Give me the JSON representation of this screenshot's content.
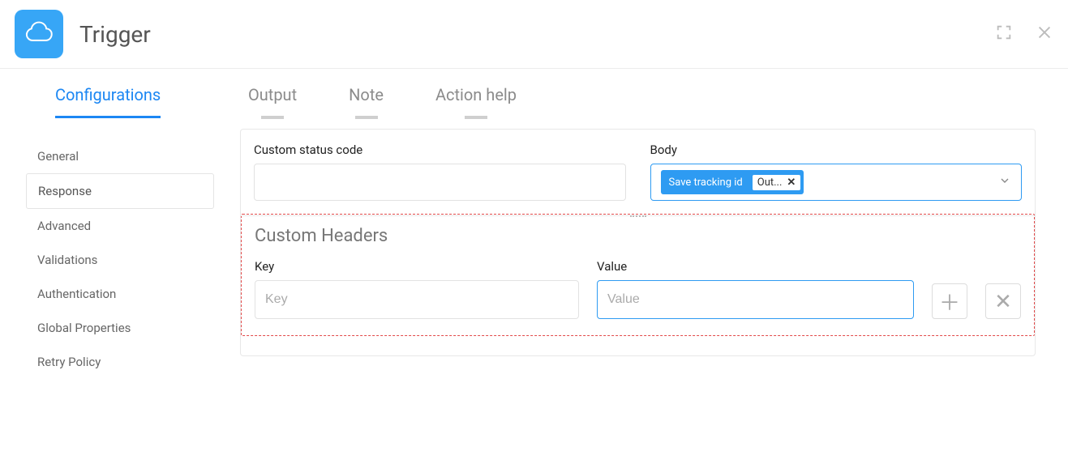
{
  "header": {
    "title": "Trigger"
  },
  "tabs": {
    "active": "Configurations",
    "others": [
      "Output",
      "Note",
      "Action help"
    ]
  },
  "sidebar": {
    "items": [
      {
        "label": "General",
        "active": false
      },
      {
        "label": "Response",
        "active": true
      },
      {
        "label": "Advanced",
        "active": false
      },
      {
        "label": "Validations",
        "active": false
      },
      {
        "label": "Authentication",
        "active": false
      },
      {
        "label": "Global Properties",
        "active": false
      },
      {
        "label": "Retry Policy",
        "active": false
      }
    ]
  },
  "fields": {
    "status_code_label": "Custom status code",
    "status_code_value": "",
    "body_label": "Body",
    "body_chip_label": "Save tracking id",
    "body_chip_inner": "Out..."
  },
  "custom_headers": {
    "title": "Custom Headers",
    "key_label": "Key",
    "key_placeholder": "Key",
    "value_label": "Value",
    "value_placeholder": "Value"
  }
}
